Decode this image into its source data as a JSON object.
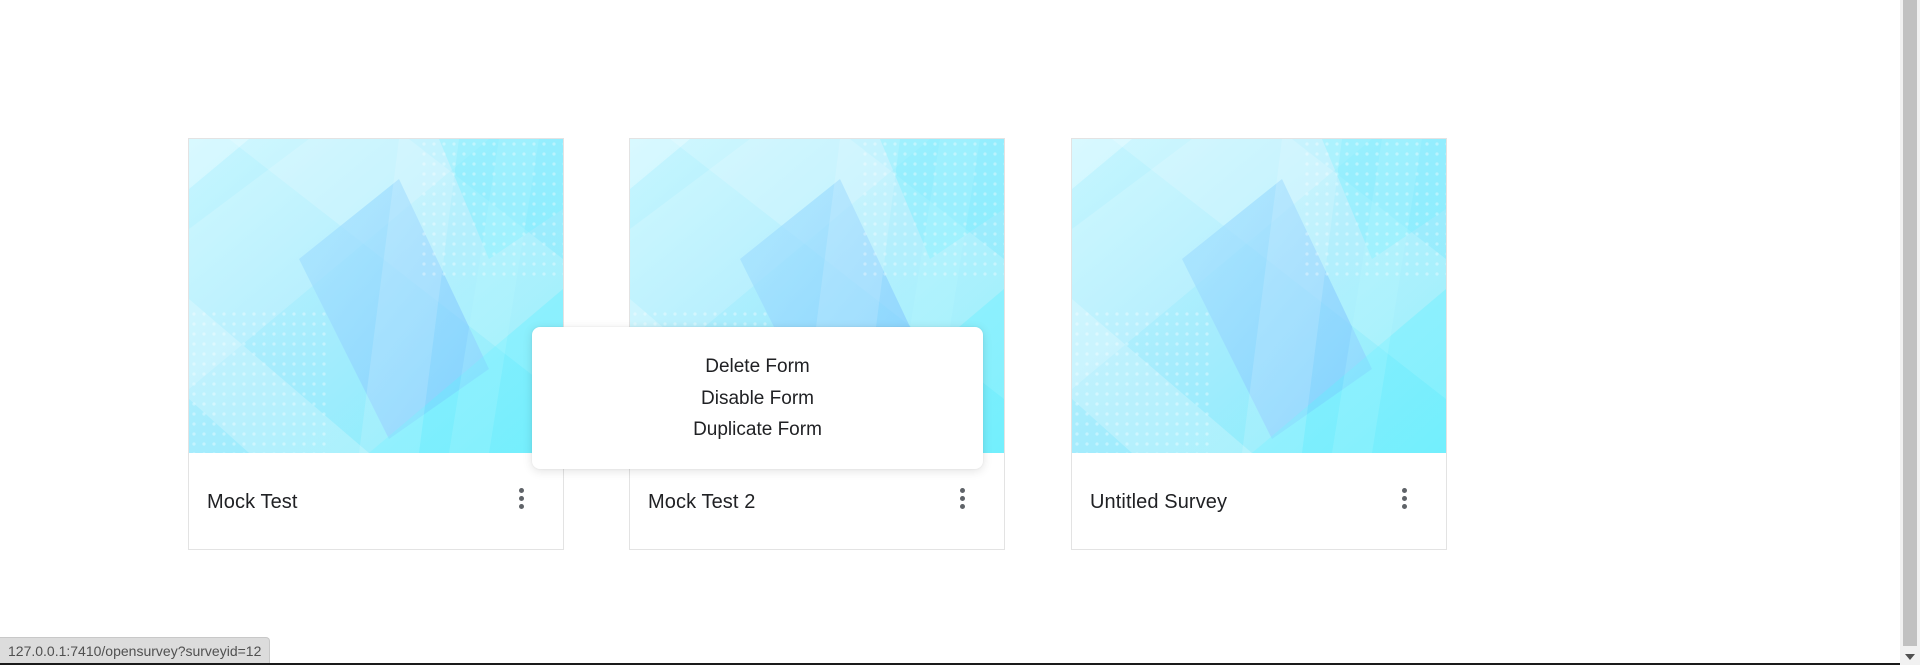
{
  "cards": [
    {
      "title": "Mock Test"
    },
    {
      "title": "Mock Test 2"
    },
    {
      "title": "Untitled Survey"
    }
  ],
  "context_menu": {
    "items": [
      {
        "label": "Delete Form"
      },
      {
        "label": "Disable Form"
      },
      {
        "label": "Duplicate Form"
      }
    ]
  },
  "status_bar": {
    "url": "127.0.0.1:7410/opensurvey?surveyid=12"
  },
  "icons": {
    "card_menu": "more-vert-icon"
  },
  "colors": {
    "thumbnail_light": "#c8f6ff",
    "thumbnail_mid": "#9ee8fb",
    "thumbnail_accent": "#7fc8ff",
    "thumbnail_cyan": "#5ef0ff"
  }
}
